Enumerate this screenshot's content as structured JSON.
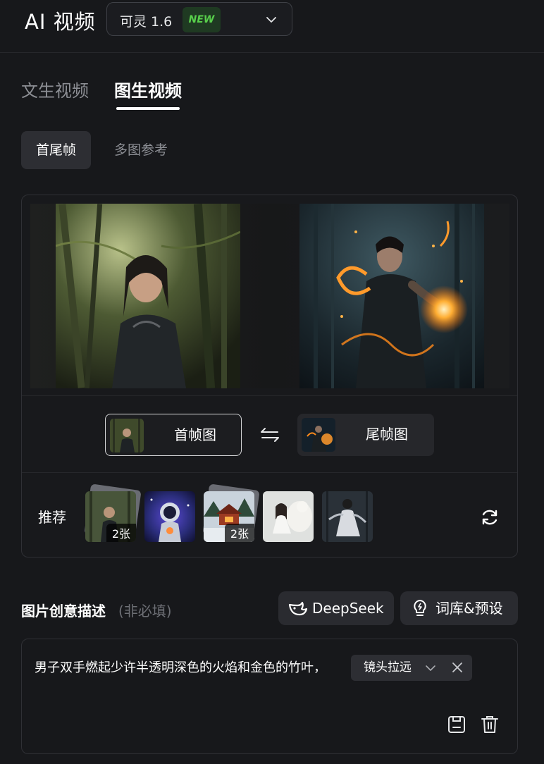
{
  "header": {
    "title": "AI 视频",
    "model": "可灵 1.6",
    "badge": "NEW"
  },
  "tabs": [
    "文生视频",
    "图生视频"
  ],
  "subtabs": [
    "首尾帧",
    "多图参考"
  ],
  "frames": {
    "first_label": "首帧图",
    "last_label": "尾帧图"
  },
  "recommend": {
    "label": "推荐",
    "items": [
      {
        "count": "2张"
      },
      {
        "count": ""
      },
      {
        "count": "2张"
      },
      {
        "count": ""
      },
      {
        "count": ""
      }
    ]
  },
  "description": {
    "title": "图片创意描述",
    "optional": "(非必填)",
    "deepseek_label": "DeepSeek",
    "library_label": "词库&预设",
    "prompt": "男子双手燃起少许半透明深色的火焰和金色的竹叶，",
    "camera_tag": "镜头拉远"
  },
  "colors": {
    "background": "#17181b",
    "accent_green": "#58d04b"
  }
}
